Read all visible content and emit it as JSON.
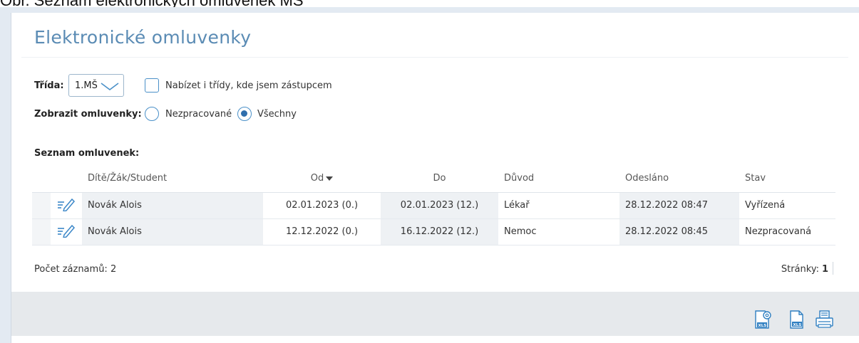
{
  "caption": "Obr. Seznam elektronických omluvenek MŠ",
  "page": {
    "title": "Elektronické omluvenky"
  },
  "filters": {
    "class_label": "Třída:",
    "class_value": "1.MŠ",
    "substitute_checkbox_label": "Nabízet i třídy, kde jsem zástupcem",
    "substitute_checked": false,
    "show_label": "Zobrazit omluvenky:",
    "option_unprocessed": "Nezpracované",
    "option_all": "Všechny",
    "selected_option": "Všechny"
  },
  "list": {
    "heading": "Seznam omluvenek:",
    "columns": {
      "student": "Dítě/Žák/Student",
      "from": "Od",
      "to": "Do",
      "reason": "Důvod",
      "sent": "Odesláno",
      "status": "Stav"
    },
    "sort_column": "from",
    "rows": [
      {
        "student": "Novák Alois",
        "from": "02.01.2023 (0.)",
        "to": "02.01.2023 (12.)",
        "reason": "Lékař",
        "sent": "28.12.2022 08:47",
        "status": "Vyřízená"
      },
      {
        "student": "Novák Alois",
        "from": "12.12.2022 (0.)",
        "to": "16.12.2022 (12.)",
        "reason": "Nemoc",
        "sent": "28.12.2022 08:45",
        "status": "Nezpracovaná"
      }
    ]
  },
  "footer": {
    "record_count": "Počet záznamů: 2",
    "pages_label": "Stránky:",
    "current_page": "1"
  },
  "toolbar": {
    "icons": [
      "xls-settings-icon",
      "xls-export-icon",
      "print-icon"
    ]
  },
  "colors": {
    "title": "#5a8bb4",
    "accent": "#2f6fad",
    "status_done": "#2f8a2f"
  }
}
